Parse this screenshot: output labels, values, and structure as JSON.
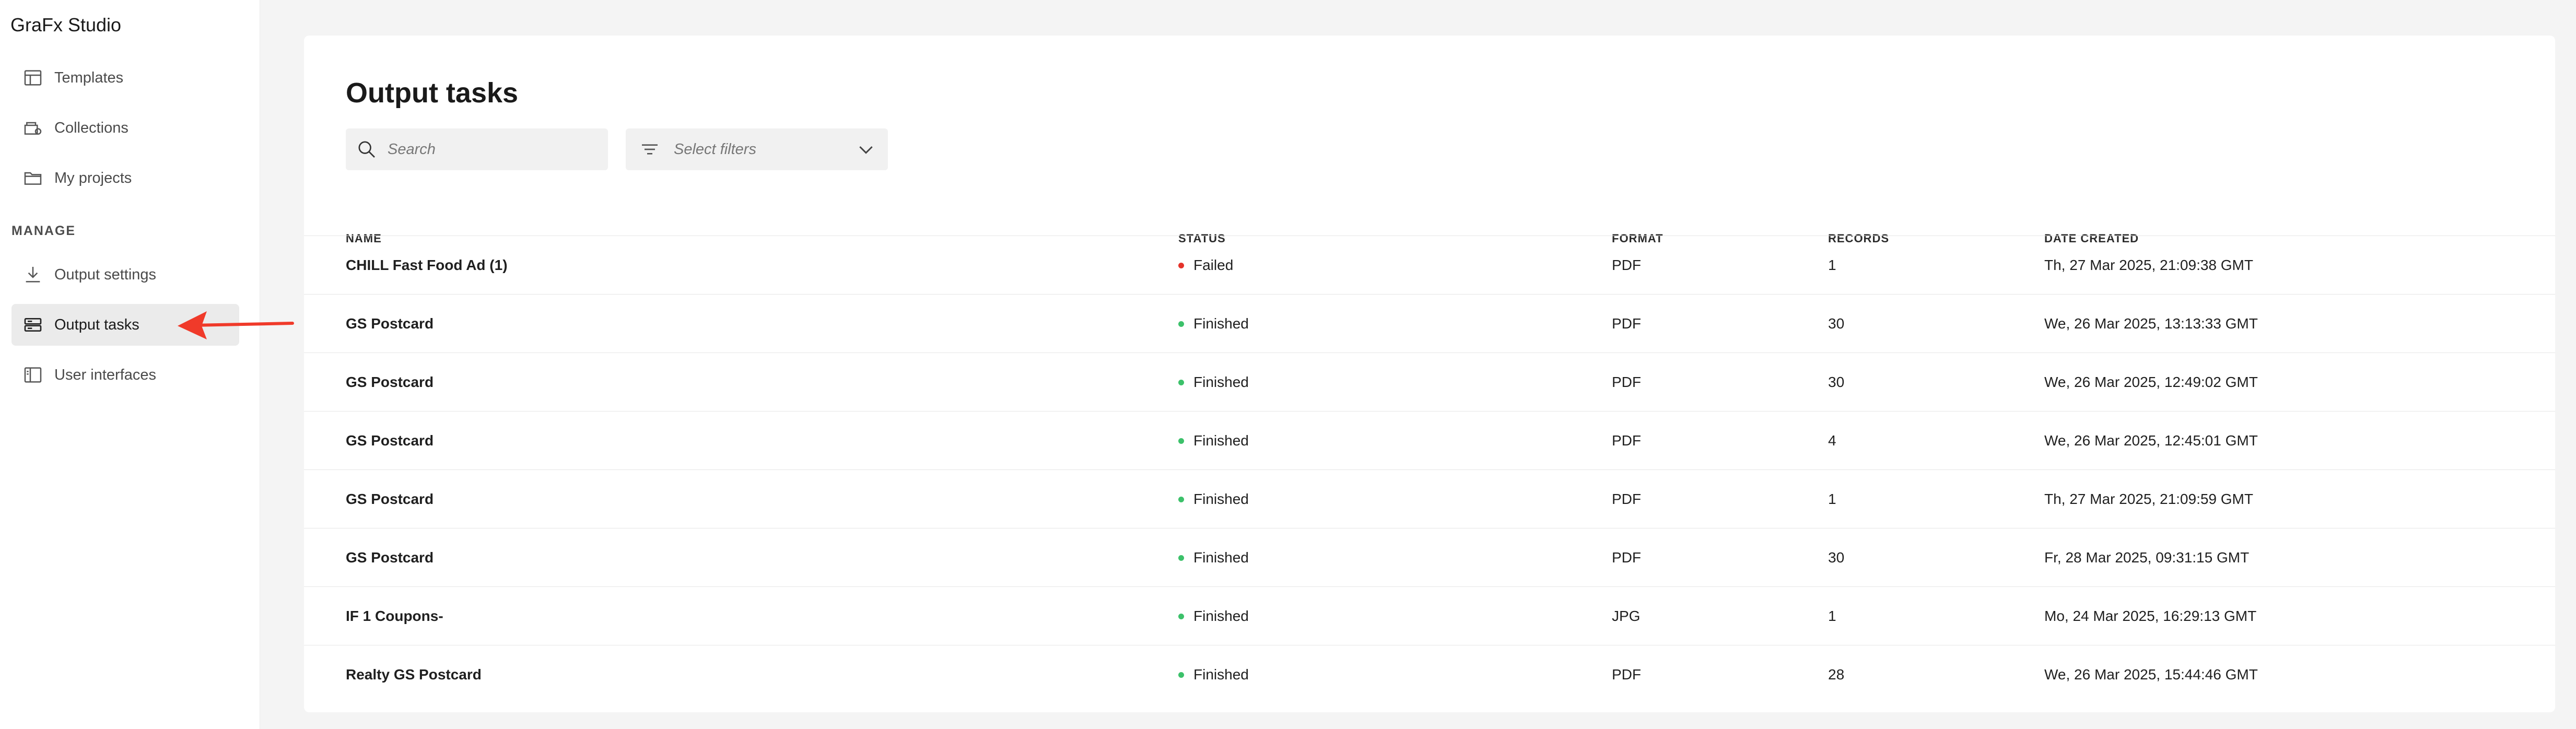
{
  "app": {
    "title": "GraFx Studio"
  },
  "sidebar": {
    "items": [
      {
        "label": "Templates",
        "icon": "templates-icon"
      },
      {
        "label": "Collections",
        "icon": "collections-icon"
      },
      {
        "label": "My projects",
        "icon": "folder-icon"
      }
    ],
    "section_label": "MANAGE",
    "manage_items": [
      {
        "label": "Output settings",
        "icon": "download-icon"
      },
      {
        "label": "Output tasks",
        "icon": "output-tasks-icon",
        "active": true
      },
      {
        "label": "User interfaces",
        "icon": "user-interfaces-icon"
      }
    ]
  },
  "main": {
    "title": "Output tasks",
    "search": {
      "placeholder": "Search"
    },
    "filter": {
      "placeholder": "Select filters"
    },
    "columns": [
      "NAME",
      "STATUS",
      "FORMAT",
      "RECORDS",
      "DATE CREATED"
    ],
    "rows": [
      {
        "name": "CHILL Fast Food Ad (1)",
        "status": "Failed",
        "status_color": "#e5332a",
        "format": "PDF",
        "records": "1",
        "date": "Th, 27 Mar 2025, 21:09:38 GMT"
      },
      {
        "name": "GS Postcard",
        "status": "Finished",
        "status_color": "#3cc16a",
        "format": "PDF",
        "records": "30",
        "date": "We, 26 Mar 2025, 13:13:33 GMT"
      },
      {
        "name": "GS Postcard",
        "status": "Finished",
        "status_color": "#3cc16a",
        "format": "PDF",
        "records": "30",
        "date": "We, 26 Mar 2025, 12:49:02 GMT"
      },
      {
        "name": "GS Postcard",
        "status": "Finished",
        "status_color": "#3cc16a",
        "format": "PDF",
        "records": "4",
        "date": "We, 26 Mar 2025, 12:45:01 GMT"
      },
      {
        "name": "GS Postcard",
        "status": "Finished",
        "status_color": "#3cc16a",
        "format": "PDF",
        "records": "1",
        "date": "Th, 27 Mar 2025, 21:09:59 GMT"
      },
      {
        "name": "GS Postcard",
        "status": "Finished",
        "status_color": "#3cc16a",
        "format": "PDF",
        "records": "30",
        "date": "Fr, 28 Mar 2025, 09:31:15 GMT"
      },
      {
        "name": "IF 1 Coupons-",
        "status": "Finished",
        "status_color": "#3cc16a",
        "format": "JPG",
        "records": "1",
        "date": "Mo, 24 Mar 2025, 16:29:13 GMT"
      },
      {
        "name": "Realty GS Postcard",
        "status": "Finished",
        "status_color": "#3cc16a",
        "format": "PDF",
        "records": "28",
        "date": "We, 26 Mar 2025, 15:44:46 GMT"
      }
    ]
  },
  "colors": {
    "accent_arrow": "#f03a2a",
    "failed": "#e5332a",
    "finished": "#3cc16a",
    "active_nav_bg": "#ebebeb"
  }
}
